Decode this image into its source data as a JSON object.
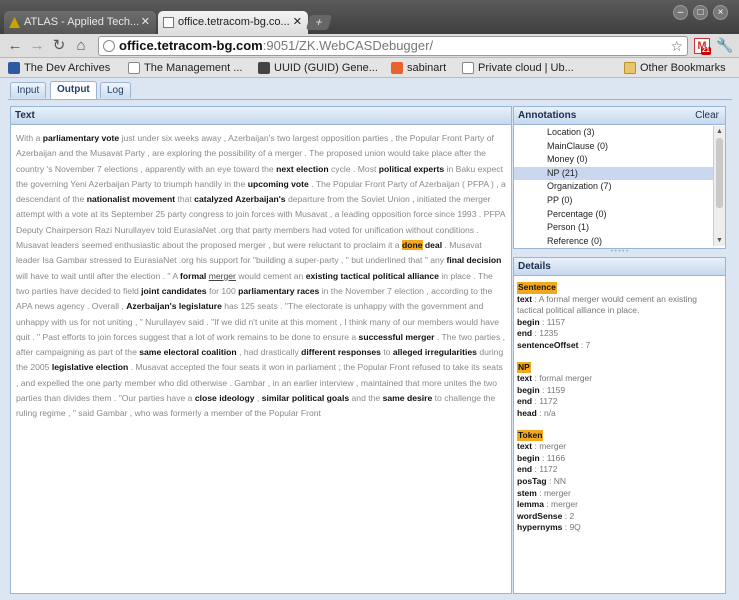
{
  "browser": {
    "tabs": [
      {
        "title": "ATLAS - Applied Tech..."
      },
      {
        "title": "office.tetracom-bg.co..."
      }
    ],
    "url": {
      "host": "office.tetracom-bg.com",
      "rest": ":9051/ZK.WebCASDebugger/"
    },
    "gmail_badge": "21",
    "bookmarks": [
      {
        "label": "The Dev Archives",
        "icon_color": "#2d5aa0"
      },
      {
        "label": "The Management ...",
        "icon_color": "#2d5aa0"
      },
      {
        "label": "UUID (GUID) Gene...",
        "icon_color": "#444444"
      },
      {
        "label": "sabinart",
        "icon_color": "#e8622c"
      },
      {
        "label": "Private cloud | Ub...",
        "icon_color": "#ffffff"
      }
    ],
    "other_bookmarks": "Other Bookmarks"
  },
  "app": {
    "tabs": [
      "Input",
      "Output",
      "Log"
    ],
    "selected_tab": "Output",
    "text_panel": {
      "title": "Text",
      "segments": [
        {
          "t": "With a "
        },
        {
          "t": "parliamentary vote",
          "b": true
        },
        {
          "t": " just under six weeks away , Azerbaijan's two largest opposition parties , the Popular Front Party of Azerbaijan and the Musavat Party , are exploring the possibility of a merger . The proposed union would take place after the country 's November 7 elections , apparently with an eye toward the "
        },
        {
          "t": "next election",
          "b": true
        },
        {
          "t": " cycle . Most "
        },
        {
          "t": "political experts",
          "b": true
        },
        {
          "t": " in Baku expect the governing Yeni Azerbaijan Party to triumph handily in the "
        },
        {
          "t": "upcoming vote",
          "b": true
        },
        {
          "t": " . The Popular Front Party of Azerbaijan ( PFPA ) , a descendant of the "
        },
        {
          "t": "nationalist movement",
          "b": true
        },
        {
          "t": " that "
        },
        {
          "t": "catalyzed",
          "b": true
        },
        {
          "t": " "
        },
        {
          "t": "Azerbaijan's",
          "b": true
        },
        {
          "t": " departure from the Soviet Union , initiated the merger attempt with a vote at its September 25 party congress to join forces with Musavat , a leading opposition force since 1993 . PFPA Deputy Chairperson Razi Nurullayev told EurasiaNet .org that party members had voted for unification without conditions . Musavat leaders seemed enthusiastic about the proposed merger , but were reluctant to proclaim it a "
        },
        {
          "t": "done",
          "hl": true
        },
        {
          "t": " "
        },
        {
          "t": "deal",
          "b": true
        },
        {
          "t": " . Musavat leader Isa Gambar stressed to EurasiaNet .org his support for \"building a super-party , \" but underlined that \" any "
        },
        {
          "t": "final decision",
          "b": true
        },
        {
          "t": " will have to wait until after the election . \" A "
        },
        {
          "t": "formal",
          "b": true
        },
        {
          "t": " "
        },
        {
          "t": "merger",
          "u": true
        },
        {
          "t": " would cement an "
        },
        {
          "t": "existing tactical political alliance",
          "b": true
        },
        {
          "t": " in place . The two parties have decided to field "
        },
        {
          "t": "joint candidates",
          "b": true
        },
        {
          "t": " for 100 "
        },
        {
          "t": "parliamentary races",
          "b": true
        },
        {
          "t": " in the November 7 election , according to the APA news agency . Overall , "
        },
        {
          "t": "Azerbaijan's legislature",
          "b": true
        },
        {
          "t": " has 125 seats . \"The electorate is unhappy with the government and unhappy with us for not uniting , \" Nurullayev said . \"If we did n't unite at this moment , I think many of our members would have quit . \" Past efforts to join forces suggest that a lot of work remains to be done to ensure a "
        },
        {
          "t": "successful merger",
          "b": true
        },
        {
          "t": " . The two parties , after campaigning as part of the "
        },
        {
          "t": "same electoral coalition",
          "b": true
        },
        {
          "t": " , had drastically "
        },
        {
          "t": "different responses",
          "b": true
        },
        {
          "t": " to "
        },
        {
          "t": "alleged irregularities",
          "b": true
        },
        {
          "t": " during the 2005 "
        },
        {
          "t": "legislative election",
          "b": true
        },
        {
          "t": " . Musavat accepted the four seats it won in parliament ; the Popular Front refused to take its seats , and expelled the one party member who did otherwise . Gambar , in an earlier interview , maintained that more unites the two parties than divides them . \"Our parties have a "
        },
        {
          "t": "close ideology",
          "b": true
        },
        {
          "t": " , "
        },
        {
          "t": "similar political goals",
          "b": true
        },
        {
          "t": " and the "
        },
        {
          "t": "same desire",
          "b": true
        },
        {
          "t": " to challenge the ruling regime , \" said Gambar , who was formerly a member of the Popular Front"
        }
      ]
    },
    "annotations_panel": {
      "title": "Annotations",
      "clear_label": "Clear",
      "items": [
        "Location (3)",
        "MainClause (0)",
        "Money (0)",
        "NP (21)",
        "Organization (7)",
        "PP (0)",
        "Percentage (0)",
        "Person (1)",
        "Reference (0)"
      ],
      "selected_index": 3
    },
    "details_panel": {
      "title": "Details",
      "sections": [
        {
          "heading": "Sentence",
          "fields": [
            {
              "k": "text",
              "v": "A formal merger would cement an existing tactical political alliance in place."
            },
            {
              "k": "begin",
              "v": "1157"
            },
            {
              "k": "end",
              "v": "1235"
            },
            {
              "k": "sentenceOffset",
              "v": "7"
            }
          ]
        },
        {
          "heading": "NP",
          "fields": [
            {
              "k": "text",
              "v": "formal merger"
            },
            {
              "k": "begin",
              "v": "1159"
            },
            {
              "k": "end",
              "v": "1172"
            },
            {
              "k": "head",
              "v": "n/a"
            }
          ]
        },
        {
          "heading": "Token",
          "fields": [
            {
              "k": "text",
              "v": "merger"
            },
            {
              "k": "begin",
              "v": "1166"
            },
            {
              "k": "end",
              "v": "1172"
            },
            {
              "k": "posTag",
              "v": "NN"
            },
            {
              "k": "stem",
              "v": "merger"
            },
            {
              "k": "lemma",
              "v": "merger"
            },
            {
              "k": "wordSense",
              "v": "2"
            },
            {
              "k": "hypernyms",
              "v": "9Q"
            }
          ]
        }
      ]
    }
  },
  "colors": {
    "highlight": "#f3a91d",
    "panel_header": "#c6d8ee",
    "app_bg": "#dbe6f2"
  }
}
